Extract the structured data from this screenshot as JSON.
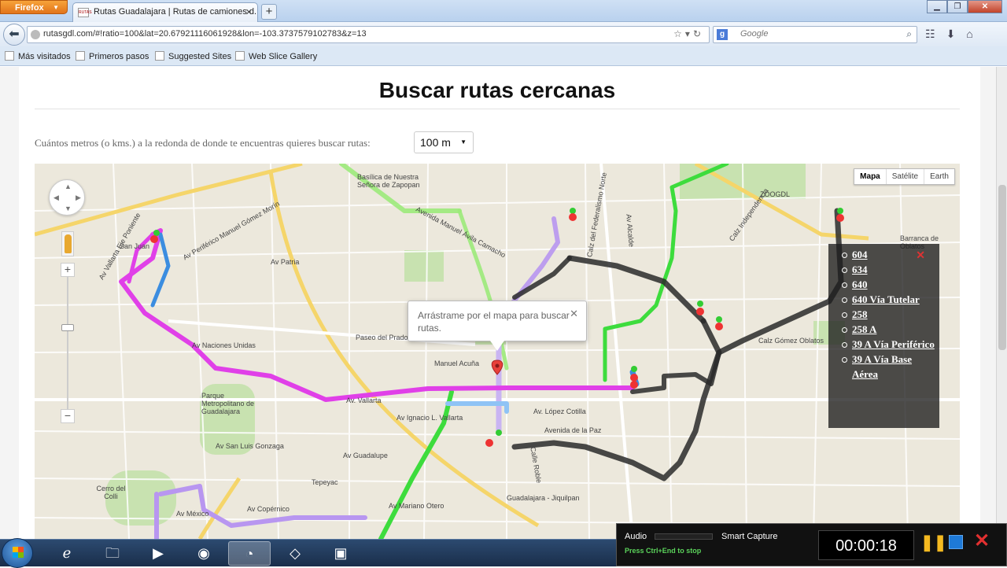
{
  "browser": {
    "app_button": "Firefox",
    "tab_title": "Rutas Guadalajara | Rutas de camiones d...",
    "url": "rutasgdl.com/#!ratio=100&lat=20.67921116061928&lon=-103.3737579102783&z=13",
    "search_placeholder": "Google",
    "bookmarks": [
      "Más visitados",
      "Primeros pasos",
      "Suggested Sites",
      "Web Slice Gallery"
    ]
  },
  "page": {
    "title": "Buscar rutas cercanas",
    "question": "Cuántos metros (o kms.) a la redonda de donde te encuentras quieres buscar rutas:",
    "radius_selected": "100 m"
  },
  "map": {
    "type_buttons": [
      "Mapa",
      "Satélite",
      "Earth"
    ],
    "active_type": "Mapa",
    "infowindow_text": "Arrástrame por el mapa para buscar rutas.",
    "labels": {
      "basilica": "Basílica de Nuestra Señora de Zapopan",
      "zoo": "ZOOGDL",
      "barranca": "Barranca de Oblatos",
      "san_juan": "San Juan",
      "parque": "Parque Metropolitano de Guadalajara",
      "cerro": "Cerro del Colli",
      "av_vallarta": "Av. Vallarta",
      "av_nac_unidas": "Av Naciones Unidas",
      "paseo_prado": "Paseo del Prado",
      "manuel_acuna": "Manuel Acuña",
      "av_lopez_cotilla": "Av. López Cotilla",
      "avenida_hidalgo": "Avenida de la Paz",
      "av_guadalupe": "Av Guadalupe",
      "av_patria": "Av Patria",
      "periferico": "Av Periférico Manuel Gómez Morín",
      "av_vallarta_eje": "Av Vallarta Eje Poniente",
      "av_avila": "Avenida Manuel Ávila Camacho",
      "av_alcalde": "Av Alcalde",
      "av_federalismo": "Calz del Federalismo Norte",
      "calz_indep": "Calz Independencia",
      "av_mexico": "Av México",
      "av_sl_gonzaga": "Av San Luis Gonzaga",
      "av_ignacio": "Av Ignacio L. Vallarta",
      "guadalajara_jiquilpan": "Guadalajara - Jiquilpan",
      "calz_oblatos": "Calz Gómez Oblatos",
      "av_copernico": "Av Copérnico",
      "tepeyac": "Tepeyac",
      "calle_roble": "Calle Roble",
      "av_malecon": "Av Mariano Otero"
    },
    "route_list": [
      "604",
      "634",
      "640",
      "640 Vía Tutelar",
      "258",
      "258 A",
      "39 A Vía Periférico",
      "39 A Vía Base Aérea"
    ]
  },
  "recorder": {
    "audio_label": "Audio",
    "mode_label": "Smart Capture",
    "hint": "Press Ctrl+End to stop",
    "time": "00:00:18"
  },
  "colors": {
    "route_pink": "#e040e8",
    "route_green": "#3ddc3d",
    "route_lightgreen": "#9cea7a",
    "route_purple": "#b896f0",
    "route_black": "#2a2a2a",
    "route_blue": "#3b8de0"
  }
}
